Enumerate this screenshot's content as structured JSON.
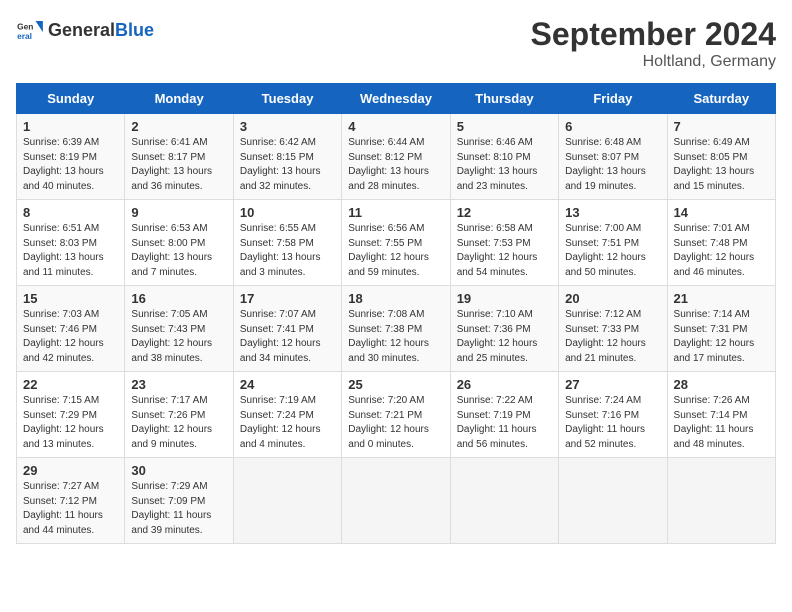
{
  "header": {
    "logo_general": "General",
    "logo_blue": "Blue",
    "month_title": "September 2024",
    "location": "Holtland, Germany"
  },
  "weekdays": [
    "Sunday",
    "Monday",
    "Tuesday",
    "Wednesday",
    "Thursday",
    "Friday",
    "Saturday"
  ],
  "weeks": [
    [
      {
        "day": "1",
        "info": "Sunrise: 6:39 AM\nSunset: 8:19 PM\nDaylight: 13 hours\nand 40 minutes."
      },
      {
        "day": "2",
        "info": "Sunrise: 6:41 AM\nSunset: 8:17 PM\nDaylight: 13 hours\nand 36 minutes."
      },
      {
        "day": "3",
        "info": "Sunrise: 6:42 AM\nSunset: 8:15 PM\nDaylight: 13 hours\nand 32 minutes."
      },
      {
        "day": "4",
        "info": "Sunrise: 6:44 AM\nSunset: 8:12 PM\nDaylight: 13 hours\nand 28 minutes."
      },
      {
        "day": "5",
        "info": "Sunrise: 6:46 AM\nSunset: 8:10 PM\nDaylight: 13 hours\nand 23 minutes."
      },
      {
        "day": "6",
        "info": "Sunrise: 6:48 AM\nSunset: 8:07 PM\nDaylight: 13 hours\nand 19 minutes."
      },
      {
        "day": "7",
        "info": "Sunrise: 6:49 AM\nSunset: 8:05 PM\nDaylight: 13 hours\nand 15 minutes."
      }
    ],
    [
      {
        "day": "8",
        "info": "Sunrise: 6:51 AM\nSunset: 8:03 PM\nDaylight: 13 hours\nand 11 minutes."
      },
      {
        "day": "9",
        "info": "Sunrise: 6:53 AM\nSunset: 8:00 PM\nDaylight: 13 hours\nand 7 minutes."
      },
      {
        "day": "10",
        "info": "Sunrise: 6:55 AM\nSunset: 7:58 PM\nDaylight: 13 hours\nand 3 minutes."
      },
      {
        "day": "11",
        "info": "Sunrise: 6:56 AM\nSunset: 7:55 PM\nDaylight: 12 hours\nand 59 minutes."
      },
      {
        "day": "12",
        "info": "Sunrise: 6:58 AM\nSunset: 7:53 PM\nDaylight: 12 hours\nand 54 minutes."
      },
      {
        "day": "13",
        "info": "Sunrise: 7:00 AM\nSunset: 7:51 PM\nDaylight: 12 hours\nand 50 minutes."
      },
      {
        "day": "14",
        "info": "Sunrise: 7:01 AM\nSunset: 7:48 PM\nDaylight: 12 hours\nand 46 minutes."
      }
    ],
    [
      {
        "day": "15",
        "info": "Sunrise: 7:03 AM\nSunset: 7:46 PM\nDaylight: 12 hours\nand 42 minutes."
      },
      {
        "day": "16",
        "info": "Sunrise: 7:05 AM\nSunset: 7:43 PM\nDaylight: 12 hours\nand 38 minutes."
      },
      {
        "day": "17",
        "info": "Sunrise: 7:07 AM\nSunset: 7:41 PM\nDaylight: 12 hours\nand 34 minutes."
      },
      {
        "day": "18",
        "info": "Sunrise: 7:08 AM\nSunset: 7:38 PM\nDaylight: 12 hours\nand 30 minutes."
      },
      {
        "day": "19",
        "info": "Sunrise: 7:10 AM\nSunset: 7:36 PM\nDaylight: 12 hours\nand 25 minutes."
      },
      {
        "day": "20",
        "info": "Sunrise: 7:12 AM\nSunset: 7:33 PM\nDaylight: 12 hours\nand 21 minutes."
      },
      {
        "day": "21",
        "info": "Sunrise: 7:14 AM\nSunset: 7:31 PM\nDaylight: 12 hours\nand 17 minutes."
      }
    ],
    [
      {
        "day": "22",
        "info": "Sunrise: 7:15 AM\nSunset: 7:29 PM\nDaylight: 12 hours\nand 13 minutes."
      },
      {
        "day": "23",
        "info": "Sunrise: 7:17 AM\nSunset: 7:26 PM\nDaylight: 12 hours\nand 9 minutes."
      },
      {
        "day": "24",
        "info": "Sunrise: 7:19 AM\nSunset: 7:24 PM\nDaylight: 12 hours\nand 4 minutes."
      },
      {
        "day": "25",
        "info": "Sunrise: 7:20 AM\nSunset: 7:21 PM\nDaylight: 12 hours\nand 0 minutes."
      },
      {
        "day": "26",
        "info": "Sunrise: 7:22 AM\nSunset: 7:19 PM\nDaylight: 11 hours\nand 56 minutes."
      },
      {
        "day": "27",
        "info": "Sunrise: 7:24 AM\nSunset: 7:16 PM\nDaylight: 11 hours\nand 52 minutes."
      },
      {
        "day": "28",
        "info": "Sunrise: 7:26 AM\nSunset: 7:14 PM\nDaylight: 11 hours\nand 48 minutes."
      }
    ],
    [
      {
        "day": "29",
        "info": "Sunrise: 7:27 AM\nSunset: 7:12 PM\nDaylight: 11 hours\nand 44 minutes."
      },
      {
        "day": "30",
        "info": "Sunrise: 7:29 AM\nSunset: 7:09 PM\nDaylight: 11 hours\nand 39 minutes."
      },
      {
        "day": "",
        "info": ""
      },
      {
        "day": "",
        "info": ""
      },
      {
        "day": "",
        "info": ""
      },
      {
        "day": "",
        "info": ""
      },
      {
        "day": "",
        "info": ""
      }
    ]
  ]
}
